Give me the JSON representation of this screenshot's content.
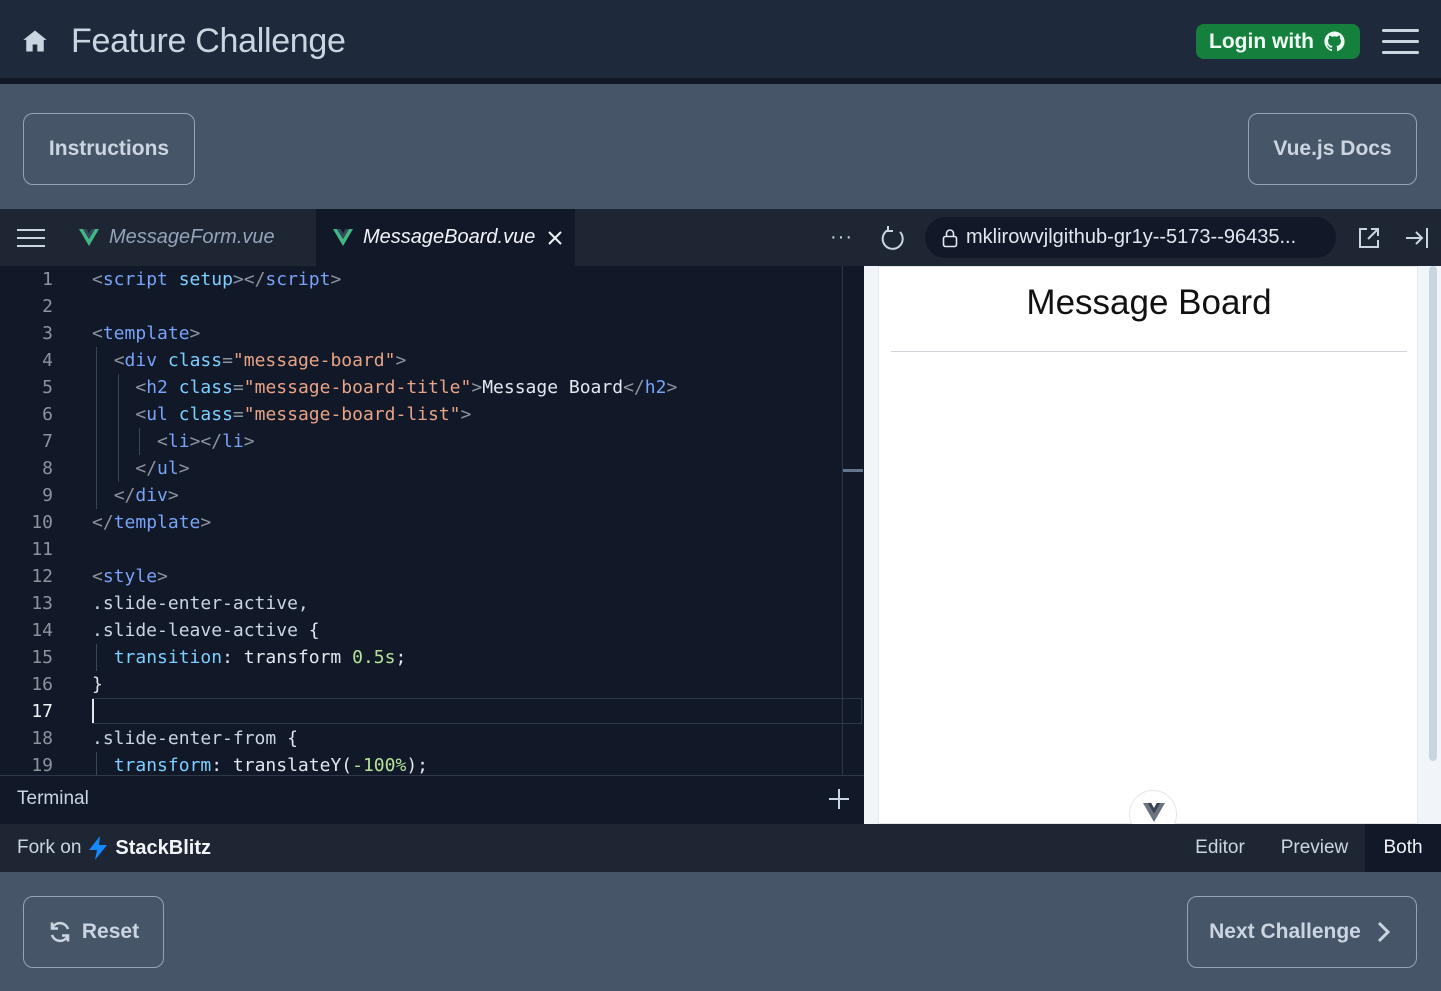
{
  "header": {
    "title": "Feature Challenge",
    "login_label": "Login with"
  },
  "actions": {
    "instructions_label": "Instructions",
    "docs_label": "Vue.js Docs",
    "reset_label": "Reset",
    "next_label": "Next Challenge"
  },
  "editor": {
    "tabs": [
      {
        "label": "MessageForm.vue",
        "active": false
      },
      {
        "label": "MessageBoard.vue",
        "active": true
      }
    ],
    "more_label": "···",
    "active_line": 17,
    "line_numbers": [
      "1",
      "2",
      "3",
      "4",
      "5",
      "6",
      "7",
      "8",
      "9",
      "10",
      "11",
      "12",
      "13",
      "14",
      "15",
      "16",
      "17",
      "18",
      "19"
    ]
  },
  "preview": {
    "url": "mklirowvjlgithub-gr1y--5173--96435...",
    "page_title": "Message Board"
  },
  "terminal": {
    "label": "Terminal"
  },
  "footer": {
    "fork_label": "Fork on",
    "brand": "StackBlitz",
    "views": {
      "editor": "Editor",
      "preview": "Preview",
      "both": "Both"
    },
    "selected_view": "Both"
  },
  "colors": {
    "header_bg": "#1e293b",
    "page_bg": "#475569",
    "login_green": "#15803d",
    "editor_bg": "#111827"
  }
}
